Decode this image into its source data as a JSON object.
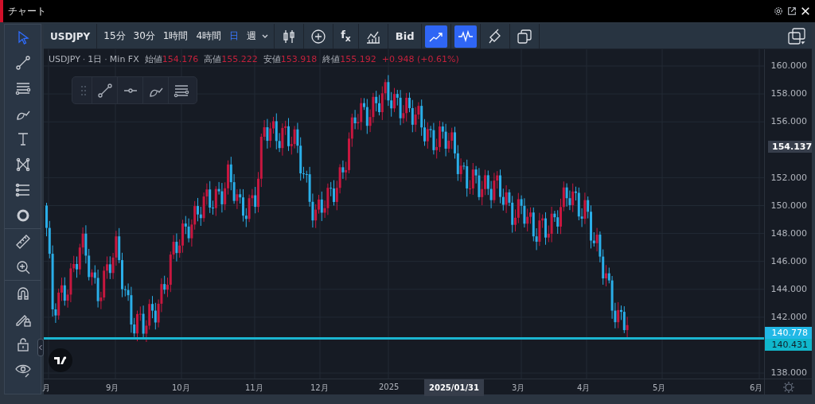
{
  "window": {
    "title": "チャート"
  },
  "left_toolbar": {
    "groups": [
      {
        "tools": [
          {
            "kind": "cursor",
            "selected": true
          },
          {
            "kind": "trend-line",
            "selected": false
          },
          {
            "kind": "parallel-lines",
            "selected": false
          },
          {
            "kind": "brush",
            "selected": false
          },
          {
            "kind": "text",
            "selected": false
          },
          {
            "kind": "pattern",
            "selected": false
          },
          {
            "kind": "fib",
            "selected": false
          },
          {
            "kind": "ring",
            "selected": false
          }
        ]
      },
      {
        "tools": [
          {
            "kind": "ruler",
            "selected": false
          },
          {
            "kind": "zoom",
            "selected": false
          }
        ]
      },
      {
        "tools": [
          {
            "kind": "magnet",
            "selected": false
          },
          {
            "kind": "pencil-lock",
            "selected": false
          },
          {
            "kind": "lock",
            "selected": false
          },
          {
            "kind": "eye",
            "selected": false
          }
        ]
      }
    ]
  },
  "top_toolbar": {
    "symbol": "USDJPY",
    "intervals": [
      {
        "label": "15分",
        "selected": false
      },
      {
        "label": "30分",
        "selected": false
      },
      {
        "label": "1時間",
        "selected": false
      },
      {
        "label": "4時間",
        "selected": false
      },
      {
        "label": "日",
        "selected": true
      },
      {
        "label": "週",
        "selected": false
      }
    ],
    "buttons": [
      {
        "kind": "candles",
        "active": false
      },
      {
        "kind": "add",
        "active": false
      },
      {
        "kind": "label",
        "label": "f$_{x}$",
        "active": false
      },
      {
        "kind": "indicators",
        "active": false
      },
      {
        "kind": "label",
        "label": "Bid",
        "active": false
      },
      {
        "kind": "trend",
        "active": true
      },
      {
        "kind": "pulse",
        "active": true
      },
      {
        "kind": "paint",
        "active": false
      },
      {
        "kind": "copy",
        "active": false
      }
    ]
  },
  "legend": {
    "parts": [
      "USDJPY",
      "·",
      "1日",
      "·",
      "Min FX"
    ],
    "fields": [
      {
        "label": "始値",
        "value": "154.176"
      },
      {
        "label": "高値",
        "value": "155.222"
      },
      {
        "label": "安値",
        "value": "153.918"
      },
      {
        "label": "終値",
        "value": "155.192"
      }
    ],
    "change": "+0.948 (+0.61%)"
  },
  "price_axis": {
    "ticks": [
      "160.000",
      "158.000",
      "156.000",
      "152.000",
      "150.000",
      "148.000",
      "146.000",
      "144.000",
      "142.000",
      "138.000"
    ],
    "crosshair_price": "154.137",
    "last_price": "140.778",
    "line_price": "140.431"
  },
  "time_axis": {
    "ticks": [
      "月",
      "9月",
      "10月",
      "11月",
      "12月",
      "2025",
      "3月",
      "4月",
      "5月",
      "6月"
    ],
    "crosshair_date": "2025/01/31"
  }
}
